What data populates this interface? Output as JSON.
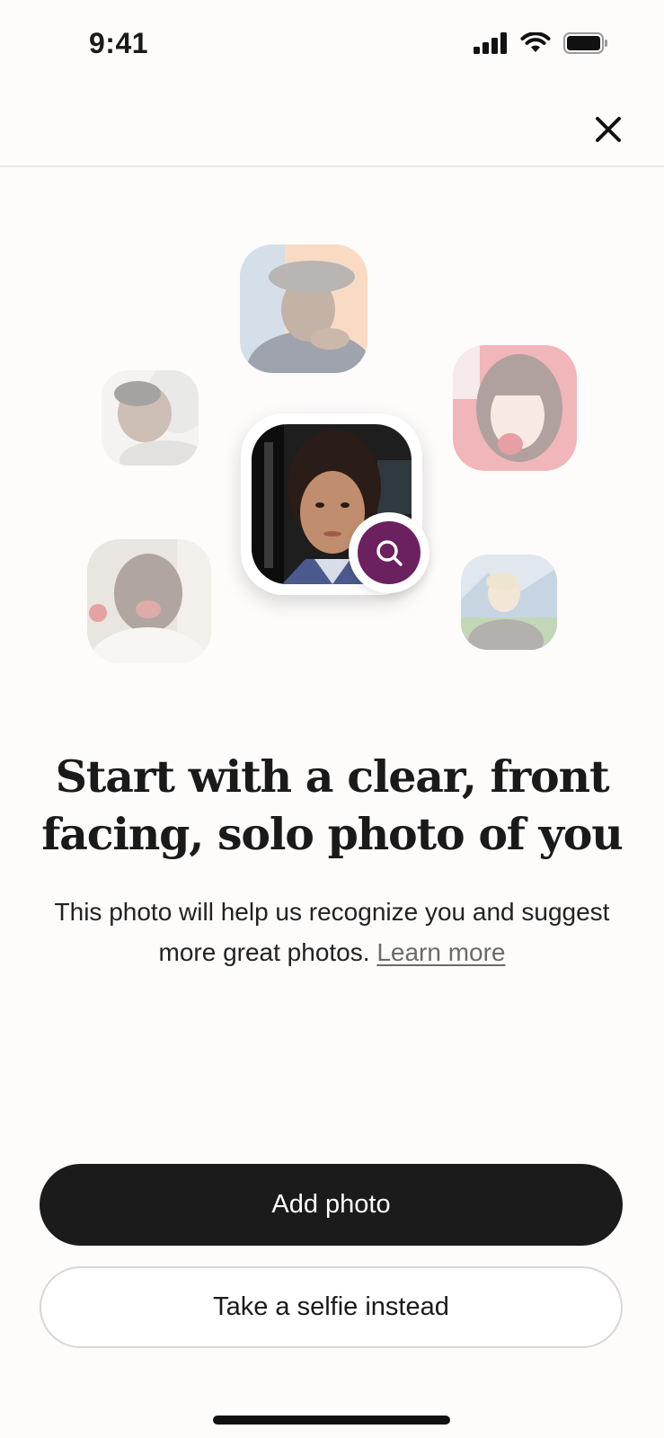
{
  "status_bar": {
    "time": "9:41",
    "icons": [
      "signal-icon",
      "wifi-icon",
      "battery-icon"
    ]
  },
  "header": {
    "close_icon": "close-icon"
  },
  "collage": {
    "photos": [
      {
        "name": "photo-person-hat"
      },
      {
        "name": "photo-person-man-lying"
      },
      {
        "name": "photo-person-red-hair"
      },
      {
        "name": "photo-person-man-laughing"
      },
      {
        "name": "photo-person-outdoor-blond"
      }
    ],
    "featured_photo": "photo-featured-woman",
    "badge_icon": "search-icon",
    "badge_color": "#6b2160"
  },
  "headline": "Start with a clear, front facing, solo photo of you",
  "subtext": "This photo will help us recognize you and suggest more great photos.",
  "learn_more_label": "Learn more",
  "buttons": {
    "add_photo": "Add photo",
    "take_selfie": "Take a selfie instead"
  },
  "colors": {
    "primary_button": "#1c1b1b",
    "accent": "#6b2160"
  }
}
